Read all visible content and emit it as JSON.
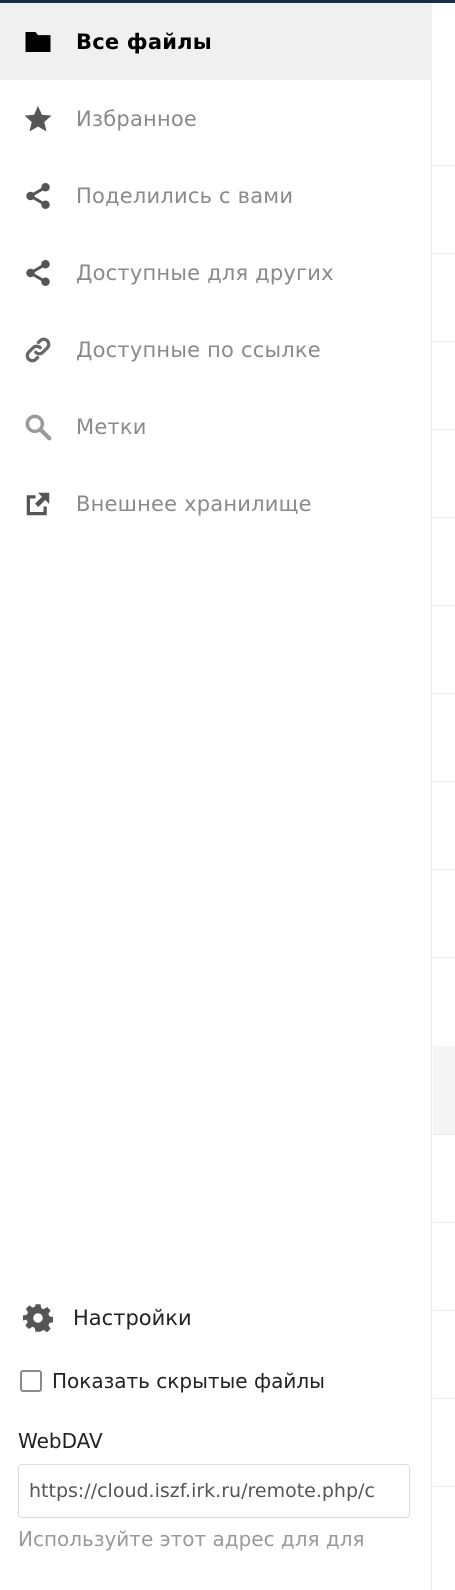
{
  "nav": {
    "items": [
      {
        "label": "Все файлы",
        "icon": "folder-icon",
        "active": true
      },
      {
        "label": "Избранное",
        "icon": "star-icon"
      },
      {
        "label": "Поделились с вами",
        "icon": "share-icon"
      },
      {
        "label": "Доступные для других",
        "icon": "share-icon"
      },
      {
        "label": "Доступные по ссылке",
        "icon": "link-icon"
      },
      {
        "label": "Метки",
        "icon": "search-icon"
      },
      {
        "label": "Внешнее хранилище",
        "icon": "external-link-icon"
      }
    ]
  },
  "settings": {
    "label": "Настройки",
    "icon": "gear-icon"
  },
  "hidden_files": {
    "label": "Показать скрытые файлы",
    "checked": false
  },
  "webdav": {
    "title": "WebDAV",
    "value": "https://cloud.iszf.irk.ru/remote.php/c",
    "help": "Используйте этот адрес для для"
  },
  "colors": {
    "active_bg": "#f0f0f0",
    "inactive_text": "#8a8a8a",
    "header_bar": "#1d2d44"
  }
}
